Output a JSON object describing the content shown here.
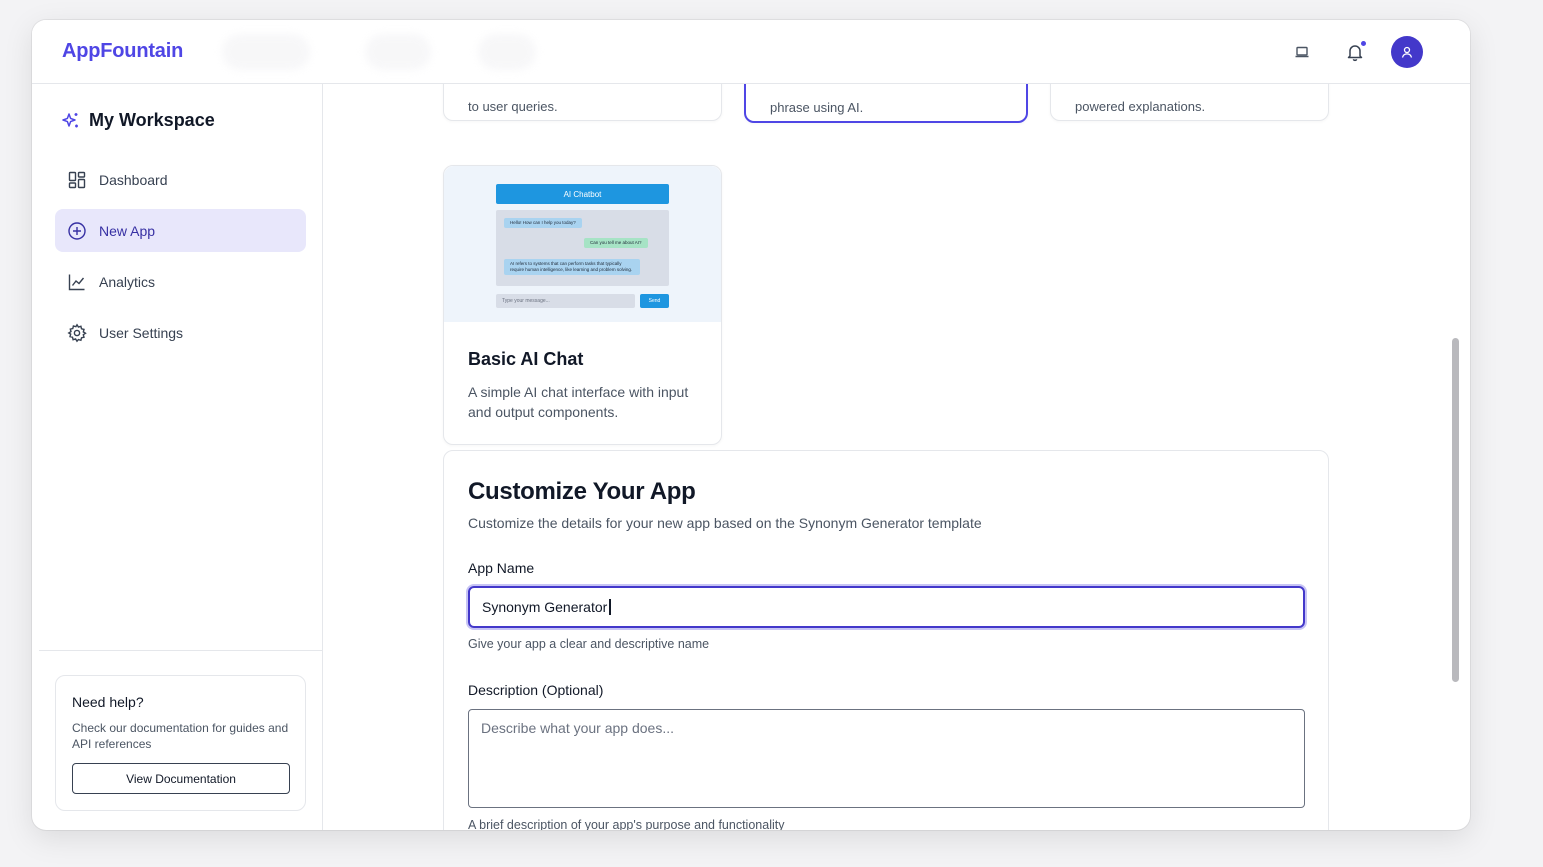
{
  "app": {
    "logo": "AppFountain"
  },
  "header": {
    "icons": [
      "laptop-icon",
      "bell-icon",
      "user-icon"
    ],
    "accent": "#4f46e5"
  },
  "sidebar": {
    "workspace_title": "My Workspace",
    "items": [
      {
        "label": "Dashboard",
        "icon": "dashboard-icon",
        "active": false
      },
      {
        "label": "New App",
        "icon": "plus-circle-icon",
        "active": true
      },
      {
        "label": "Analytics",
        "icon": "chart-line-icon",
        "active": false
      },
      {
        "label": "User Settings",
        "icon": "gear-icon",
        "active": false
      }
    ],
    "help": {
      "title": "Need help?",
      "text": "Check our documentation for guides and API references",
      "button": "View Documentation"
    }
  },
  "templates": {
    "partial": [
      {
        "text": "to user queries."
      },
      {
        "text": "phrase using AI."
      },
      {
        "text": "powered explanations."
      }
    ],
    "basic_chat": {
      "title": "Basic AI Chat",
      "description": "A simple AI chat interface with input and output components.",
      "preview": {
        "header": "AI Chatbot",
        "msg1": "Hello! How can I help you today?",
        "msg2": "Can you tell me about AI?",
        "msg3": "AI refers to systems that can perform tasks that typically require human intelligence, like learning and problem solving.",
        "input_placeholder": "Type your message...",
        "send": "Send"
      }
    }
  },
  "customize": {
    "title": "Customize Your App",
    "subtitle": "Customize the details for your new app based on the Synonym Generator template",
    "name_label": "App Name",
    "name_value": "Synonym Generator",
    "name_hint": "Give your app a clear and descriptive name",
    "desc_label": "Description (Optional)",
    "desc_placeholder": "Describe what your app does...",
    "desc_hint": "A brief description of your app's purpose and functionality"
  }
}
